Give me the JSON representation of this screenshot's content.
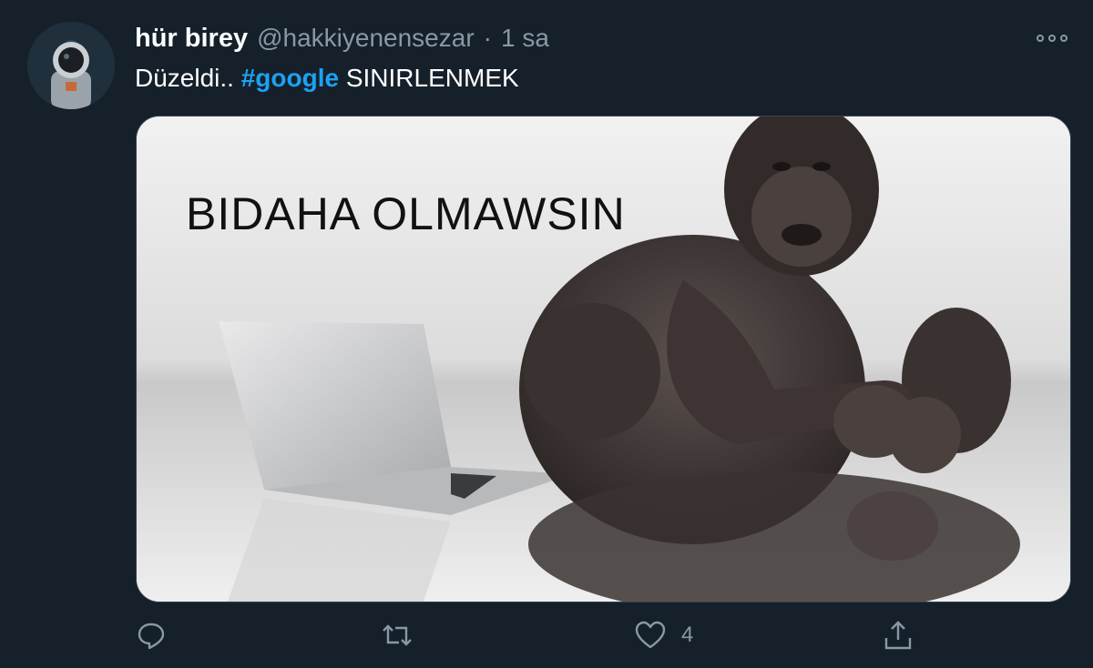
{
  "tweet": {
    "display_name": "hür birey",
    "handle": "@hakkiyenensezar",
    "separator": "·",
    "time": "1 sa",
    "text_prefix": "Düzeldi..",
    "hashtag": "#google",
    "text_suffix": "SINIRLENMEK",
    "media_caption": "BIDAHA OLMAWSIN",
    "actions": {
      "reply_count": "",
      "retweet_count": "",
      "like_count": "4",
      "share_count": ""
    }
  },
  "colors": {
    "background": "#15202b",
    "secondary_text": "#8899a6",
    "accent": "#1da1f2"
  },
  "icons": [
    "reply-icon",
    "retweet-icon",
    "like-icon",
    "share-icon",
    "more-icon"
  ]
}
